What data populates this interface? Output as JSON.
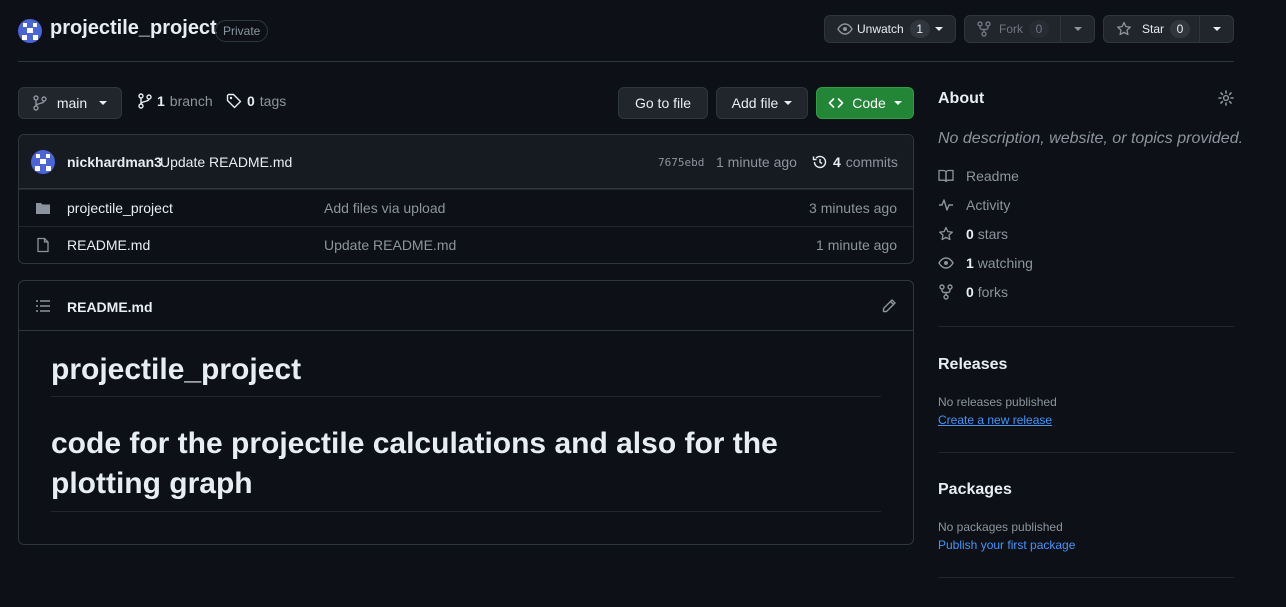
{
  "repo": {
    "name": "projectile_project",
    "visibility": "Private"
  },
  "actions": {
    "unwatch_label": "Unwatch",
    "watch_count": "1",
    "fork_label": "Fork",
    "fork_count": "0",
    "star_label": "Star",
    "star_count": "0"
  },
  "toolbar": {
    "branch": "main",
    "branch_count": "1",
    "branch_label": "branch",
    "tag_count": "0",
    "tag_label": "tags",
    "go_to_file": "Go to file",
    "add_file": "Add file",
    "code": "Code"
  },
  "latest_commit": {
    "author": "nickhardman3",
    "message": "Update README.md",
    "sha": "7675ebd",
    "time": "1 minute ago",
    "commit_count": "4",
    "commits_label": "commits"
  },
  "files": [
    {
      "type": "folder",
      "name": "projectile_project",
      "message": "Add files via upload",
      "age": "3 minutes ago"
    },
    {
      "type": "file",
      "name": "README.md",
      "message": "Update README.md",
      "age": "1 minute ago"
    }
  ],
  "readme": {
    "filename": "README.md",
    "heading1": "projectile_project",
    "heading2": "code for the projectile calculations and also for the plotting graph"
  },
  "about": {
    "title": "About",
    "description": "No description, website, or topics provided.",
    "readme_label": "Readme",
    "activity_label": "Activity",
    "stars_count": "0",
    "stars_label": "stars",
    "watching_count": "1",
    "watching_label": "watching",
    "forks_count": "0",
    "forks_label": "forks"
  },
  "releases": {
    "title": "Releases",
    "empty_text": "No releases published",
    "create_link": "Create a new release"
  },
  "packages": {
    "title": "Packages",
    "empty_text": "No packages published",
    "publish_link": "Publish your first package"
  },
  "colors": {
    "background": "#0d1117",
    "border": "#30363d",
    "primary_button": "#238636",
    "link": "#4493f8",
    "muted_text": "#8b949e"
  }
}
